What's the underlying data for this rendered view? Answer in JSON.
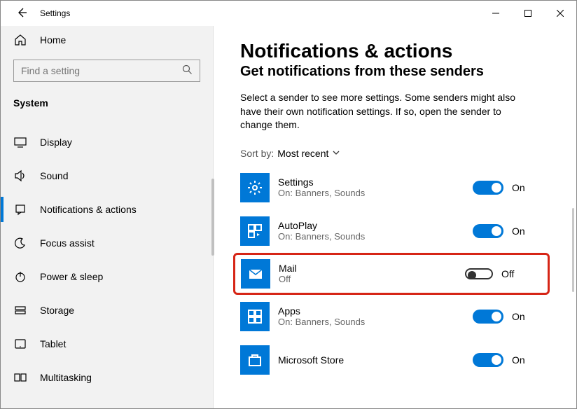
{
  "window": {
    "title": "Settings"
  },
  "sidebar": {
    "home": "Home",
    "search_placeholder": "Find a setting",
    "section": "System",
    "items": [
      {
        "label": "Display"
      },
      {
        "label": "Sound"
      },
      {
        "label": "Notifications & actions"
      },
      {
        "label": "Focus assist"
      },
      {
        "label": "Power & sleep"
      },
      {
        "label": "Storage"
      },
      {
        "label": "Tablet"
      },
      {
        "label": "Multitasking"
      }
    ]
  },
  "content": {
    "title": "Notifications & actions",
    "subtitle": "Get notifications from these senders",
    "description": "Select a sender to see more settings. Some senders might also have their own notification settings. If so, open the sender to change them.",
    "sort_label": "Sort by:",
    "sort_value": "Most recent",
    "senders": [
      {
        "name": "Settings",
        "status": "On: Banners, Sounds",
        "state": "On",
        "on": true
      },
      {
        "name": "AutoPlay",
        "status": "On: Banners, Sounds",
        "state": "On",
        "on": true
      },
      {
        "name": "Mail",
        "status": "Off",
        "state": "Off",
        "on": false,
        "highlight": true
      },
      {
        "name": "Apps",
        "status": "On: Banners, Sounds",
        "state": "On",
        "on": true
      },
      {
        "name": "Microsoft Store",
        "status": "",
        "state": "On",
        "on": true
      }
    ]
  }
}
